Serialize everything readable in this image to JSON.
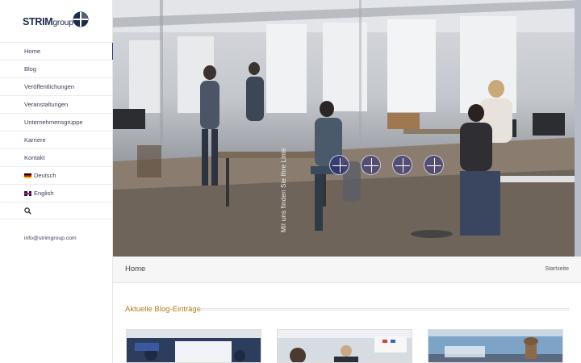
{
  "brand": {
    "name": "STRIM",
    "suffix": "group"
  },
  "sidebar": {
    "items": [
      {
        "label": "Home",
        "active": true
      },
      {
        "label": "Blog"
      },
      {
        "label": "Veröffentlichungen"
      },
      {
        "label": "Veranstaltungen"
      },
      {
        "label": "Unternehmensgruppe"
      },
      {
        "label": "Karriere"
      },
      {
        "label": "Kontakt"
      },
      {
        "label": "Deutsch",
        "flag": "de"
      },
      {
        "label": "English",
        "flag": "en"
      }
    ],
    "search_icon": "search-icon",
    "email": "info@strimgroup.com"
  },
  "hero": {
    "vertical_text": "Mit uns finden Sie Ihre Linie",
    "slider_dots": 4
  },
  "breadcrumb": {
    "title": "Home",
    "link": "Startseite"
  },
  "blog": {
    "heading": "Aktuelle Blog-Einträge"
  },
  "colors": {
    "brand_navy": "#1d2b4f",
    "accent_gold": "#b7791f",
    "dot_fill": "#2a2a78"
  }
}
